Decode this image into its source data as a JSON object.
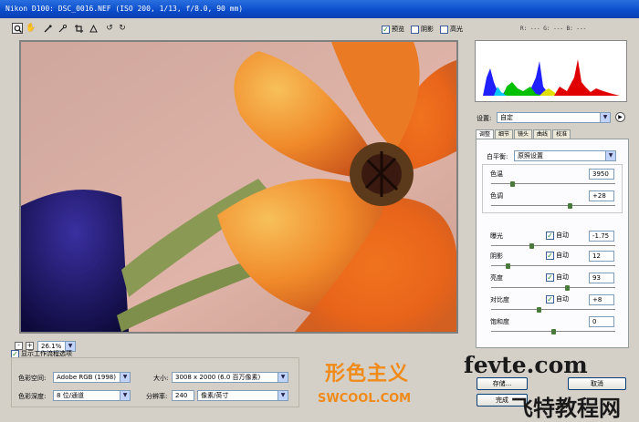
{
  "window": {
    "title": "Nikon D100: DSC_0016.NEF (ISO 200, 1/13, f/8.0, 90 mm)"
  },
  "toolbar": {
    "tools": [
      "zoom-icon",
      "hand-icon",
      "eyedropper-icon",
      "color-sampler-icon",
      "crop-icon",
      "straighten-icon",
      "rotate-left-icon",
      "rotate-right-icon"
    ],
    "preview_label": "预览",
    "shadows_label": "阴影",
    "highlights_label": "高光",
    "preview_checked": true,
    "shadows_checked": false,
    "highlights_checked": false
  },
  "readout": {
    "text": "R: ---  G: ---  B: ---"
  },
  "histogram": {
    "colors": {
      "red": "#e00000",
      "green": "#00c000",
      "blue": "#2020ff",
      "yellow": "#e0e000"
    }
  },
  "zoom": {
    "minus": "-",
    "plus": "+",
    "value": "26.1%"
  },
  "settings": {
    "label": "设置:",
    "value": "自定"
  },
  "tabs": [
    "调整",
    "细节",
    "镜头",
    "曲线",
    "校准"
  ],
  "adjust": {
    "white_balance_label": "白平衡:",
    "white_balance_value": "原照设置",
    "sliders": [
      {
        "label": "色温",
        "value": "3950",
        "auto": null,
        "level": 0.16
      },
      {
        "label": "色调",
        "value": "+28",
        "auto": null,
        "level": 0.64
      },
      {
        "label": "曝光",
        "value": "-1.75",
        "auto": "自动",
        "level": 0.32
      },
      {
        "label": "阴影",
        "value": "12",
        "auto": "自动",
        "level": 0.12
      },
      {
        "label": "亮度",
        "value": "93",
        "auto": "自动",
        "level": 0.62
      },
      {
        "label": "对比度",
        "value": "+8",
        "auto": "自动",
        "level": 0.38
      },
      {
        "label": "饱和度",
        "value": "0",
        "auto": null,
        "level": 0.5
      }
    ]
  },
  "workflow": {
    "show_label": "显示工作流程选项",
    "colorspace_label": "色彩空间:",
    "colorspace_value": "Adobe RGB (1998)",
    "depth_label": "色彩深度:",
    "depth_value": "8 位/通道",
    "size_label": "大小:",
    "size_value": "3008 x 2000  (6.0 百万像素)",
    "res_label": "分辨率:",
    "res_value": "240",
    "res_unit": "像素/英寸"
  },
  "buttons": {
    "save": "存储...",
    "cancel": "取消",
    "done": "完成"
  },
  "watermarks": {
    "left_top": "形色主义",
    "left_bottom": "SWCOOL.COM",
    "right_top": "fevte.com",
    "right_bottom": "飞特教程网"
  }
}
